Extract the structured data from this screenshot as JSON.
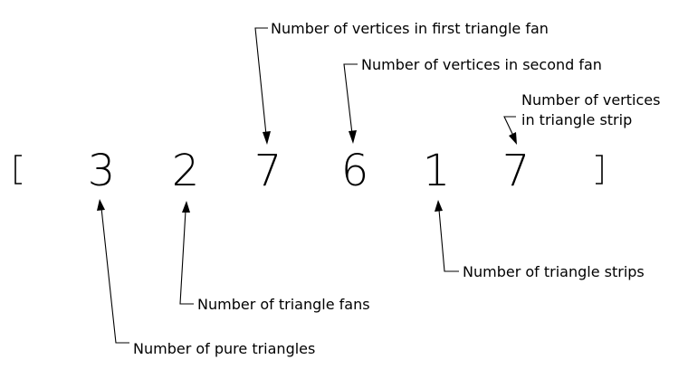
{
  "array": {
    "values": [
      "3",
      "2",
      "7",
      "6",
      "1",
      "7"
    ]
  },
  "annotations": {
    "pure_triangles": "Number of pure triangles",
    "triangle_fans": "Number of triangle fans",
    "first_fan_vertices": "Number of vertices in first triangle fan",
    "second_fan_vertices": "Number of vertices in second fan",
    "triangle_strips": "Number of triangle strips",
    "strip_vertices_line1": "Number of vertices",
    "strip_vertices_line2": "in triangle strip"
  },
  "colors": {
    "ink": "#000000",
    "background": "#ffffff"
  }
}
